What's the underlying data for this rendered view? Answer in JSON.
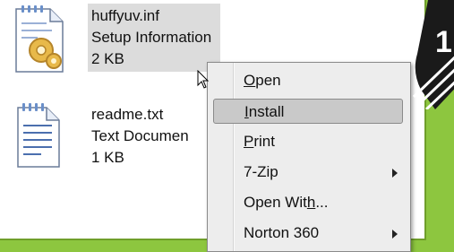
{
  "files": [
    {
      "name": "huffyuv.inf",
      "type": "Setup Information",
      "size": "2 KB",
      "icon": "setup-information-file-icon"
    },
    {
      "name": "readme.txt",
      "type": "Text Documen",
      "size": "1 KB",
      "icon": "text-document-file-icon"
    }
  ],
  "context_menu": {
    "items": [
      {
        "label": "Open",
        "mnemonic": "O",
        "highlighted": false,
        "submenu": false
      },
      {
        "label": "Install",
        "mnemonic": "I",
        "highlighted": true,
        "submenu": false
      },
      {
        "label": "Print",
        "mnemonic": "P",
        "highlighted": false,
        "submenu": false
      },
      {
        "label": "7-Zip",
        "mnemonic": "",
        "highlighted": false,
        "submenu": true
      },
      {
        "label": "Open With...",
        "mnemonic": "h",
        "highlighted": false,
        "submenu": false
      },
      {
        "label": "Norton 360",
        "mnemonic": "",
        "highlighted": false,
        "submenu": true
      }
    ]
  },
  "step_badge": {
    "number": "1"
  },
  "colors": {
    "background": "#8dc63f",
    "highlight": "#c9c9c9",
    "selection": "#dcdcdc"
  }
}
